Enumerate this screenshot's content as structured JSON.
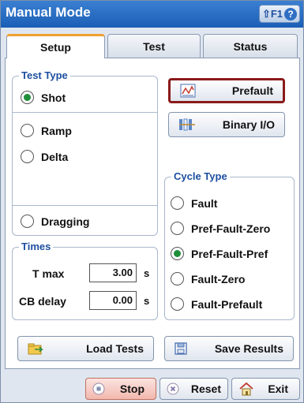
{
  "window": {
    "title": "Manual Mode",
    "help_label": "⇧F1",
    "help_glyph": "?"
  },
  "tabs": [
    {
      "label": "Setup",
      "active": true
    },
    {
      "label": "Test"
    },
    {
      "label": "Status"
    }
  ],
  "test_type": {
    "legend": "Test Type",
    "options": [
      {
        "label": "Shot",
        "selected": true
      },
      {
        "label": "Ramp"
      },
      {
        "label": "Delta"
      },
      {
        "label": "Dragging"
      }
    ]
  },
  "actions": {
    "prefault_label": "Prefault",
    "binary_io_label": "Binary I/O"
  },
  "cycle_type": {
    "legend": "Cycle Type",
    "options": [
      {
        "label": "Fault"
      },
      {
        "label": "Pref-Fault-Zero"
      },
      {
        "label": "Pref-Fault-Pref",
        "selected": true
      },
      {
        "label": "Fault-Zero"
      },
      {
        "label": "Fault-Prefault"
      }
    ]
  },
  "times": {
    "legend": "Times",
    "t_max": {
      "label": "T max",
      "value": "3.00",
      "unit": "s"
    },
    "cb_delay": {
      "label": "CB delay",
      "value": "0.00",
      "unit": "s"
    }
  },
  "panel_buttons": {
    "load_label": "Load Tests",
    "save_label": "Save Results"
  },
  "footer": {
    "stop_label": "Stop",
    "reset_label": "Reset",
    "exit_label": "Exit"
  },
  "colors": {
    "title_bar": "#1a5fb6",
    "tab_accent": "#f0a030",
    "legend_text": "#1d4fa0",
    "selected_radio": "#1f8f3a",
    "prefault_border": "#8b1a1a"
  }
}
